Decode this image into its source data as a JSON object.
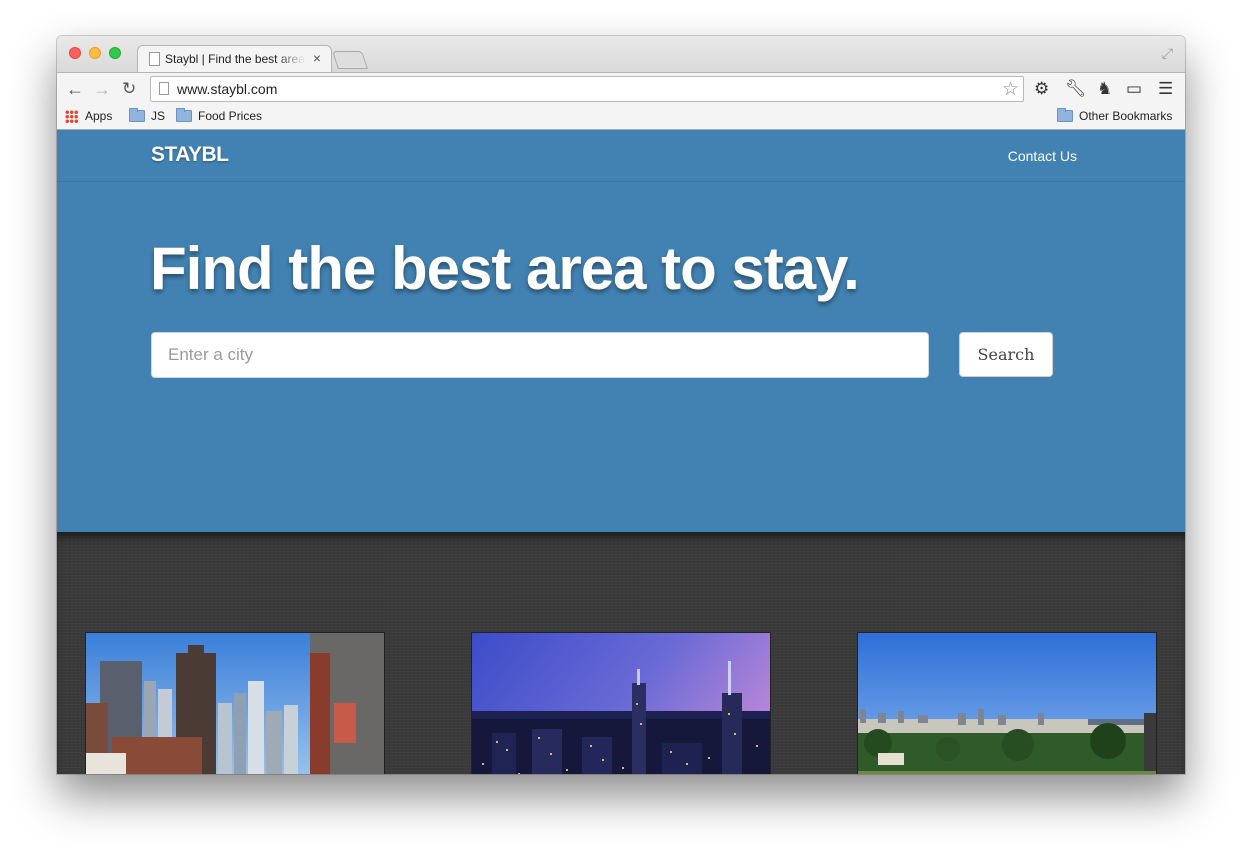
{
  "browser": {
    "tab_title": "Staybl | Find the best area to stay.",
    "tab_close": "×",
    "url": "www.staybl.com",
    "bookmarks": [
      {
        "label": "Apps",
        "icon": "apps-grid-icon"
      },
      {
        "label": "JS",
        "icon": "folder-icon"
      },
      {
        "label": "Food Prices",
        "icon": "folder-icon"
      }
    ],
    "other_bookmarks": "Other Bookmarks"
  },
  "site": {
    "brand": "STAYBL",
    "nav_contact": "Contact Us",
    "headline": "Find the best area to stay.",
    "search": {
      "placeholder": "Enter a city",
      "button": "Search"
    },
    "gallery": [
      {
        "name": "city-photo-chicago"
      },
      {
        "name": "city-photo-new-york"
      },
      {
        "name": "city-photo-san-francisco"
      }
    ]
  },
  "colors": {
    "brand_blue": "#4282b2",
    "dark_band": "#3a3a3a"
  }
}
